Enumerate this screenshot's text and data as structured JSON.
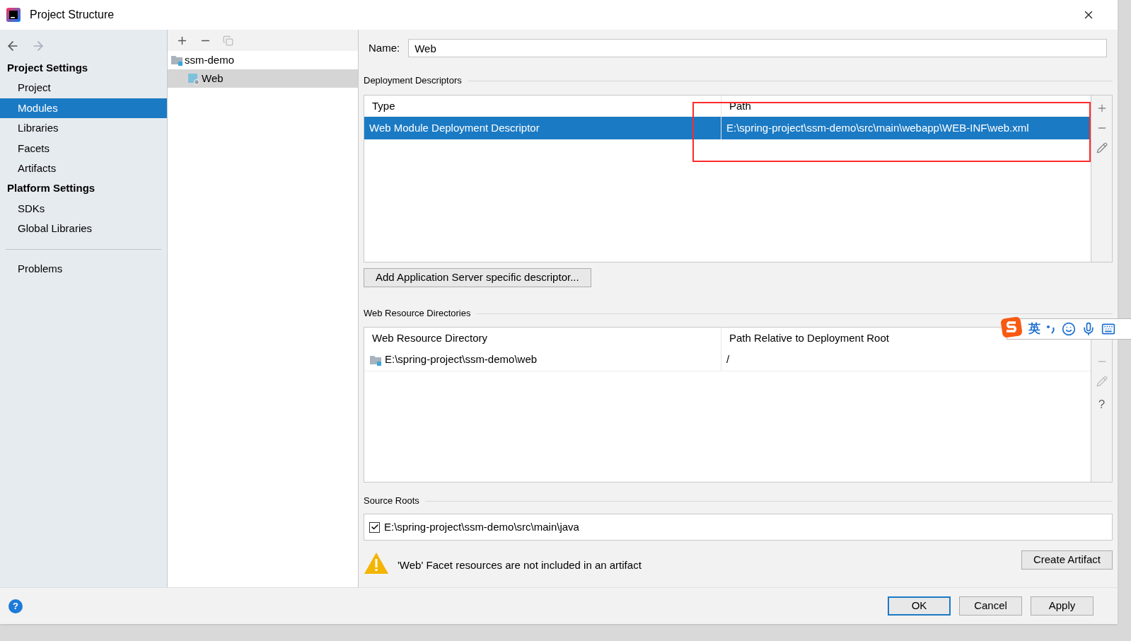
{
  "window": {
    "title": "Project Structure"
  },
  "sidebar": {
    "sections": [
      {
        "heading": "Project Settings",
        "items": [
          {
            "label": "Project",
            "selected": false
          },
          {
            "label": "Modules",
            "selected": true
          },
          {
            "label": "Libraries",
            "selected": false
          },
          {
            "label": "Facets",
            "selected": false
          },
          {
            "label": "Artifacts",
            "selected": false
          }
        ]
      },
      {
        "heading": "Platform Settings",
        "items": [
          {
            "label": "SDKs",
            "selected": false
          },
          {
            "label": "Global Libraries",
            "selected": false
          }
        ]
      }
    ],
    "footer_items": [
      {
        "label": "Problems",
        "selected": false
      }
    ]
  },
  "module_tree": {
    "items": [
      {
        "label": "ssm-demo",
        "selected": false,
        "children": [
          {
            "label": "Web",
            "selected": true
          }
        ]
      }
    ]
  },
  "name_field": {
    "label": "Name:",
    "value": "Web"
  },
  "deployment_descriptors": {
    "title": "Deployment Descriptors",
    "columns": [
      "Type",
      "Path"
    ],
    "rows": [
      {
        "cells": [
          "Web Module Deployment Descriptor",
          "E:\\spring-project\\ssm-demo\\src\\main\\webapp\\WEB-INF\\web.xml"
        ],
        "selected": true
      }
    ],
    "add_button": "Add Application Server specific descriptor..."
  },
  "web_resource_directories": {
    "title": "Web Resource Directories",
    "columns": [
      "Web Resource Directory",
      "Path Relative to Deployment Root"
    ],
    "rows": [
      {
        "cells": [
          "E:\\spring-project\\ssm-demo\\web",
          "/"
        ],
        "selected": false
      }
    ],
    "help": "?"
  },
  "source_roots": {
    "title": "Source Roots",
    "items": [
      {
        "label": "E:\\spring-project\\ssm-demo\\src\\main\\java",
        "checked": true
      }
    ]
  },
  "warning": {
    "text": "'Web' Facet resources are not included in an artifact",
    "button": "Create Artifact"
  },
  "ime_toolbar": {
    "label": "英"
  },
  "help_button": "?",
  "buttons": [
    {
      "label": "OK",
      "default": true
    },
    {
      "label": "Cancel",
      "default": false
    },
    {
      "label": "Apply",
      "default": false
    }
  ]
}
